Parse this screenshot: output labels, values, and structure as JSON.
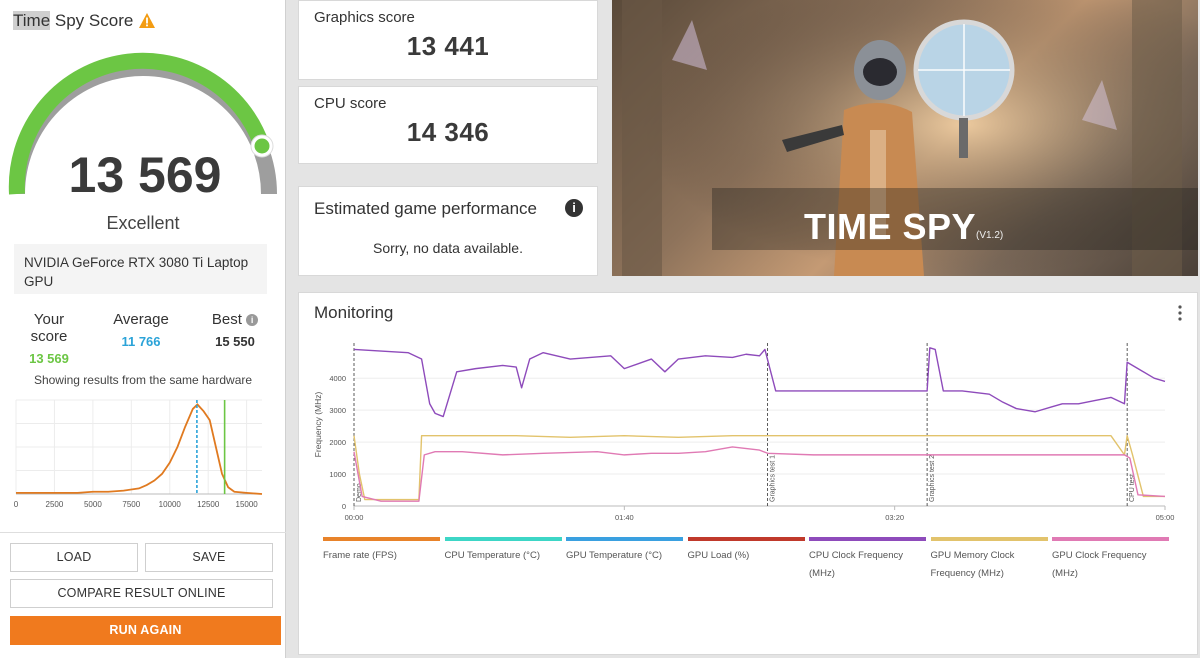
{
  "left": {
    "title_highlight": "Time",
    "title_rest": " Spy Score",
    "main_score": "13 569",
    "rating": "Excellent",
    "gpu_name": "NVIDIA GeForce RTX 3080 Ti Laptop GPU",
    "stats": {
      "your_label": "Your score",
      "your_value": "13 569",
      "avg_label": "Average",
      "avg_value": "11 766",
      "best_label": "Best",
      "best_value": "15 550"
    },
    "same_hardware_text": "Showing results from the same hardware",
    "dist_axis_labels": [
      "0",
      "2500",
      "5000",
      "7500",
      "10000",
      "12500",
      "15000"
    ],
    "buttons": {
      "load": "LOAD",
      "save": "SAVE",
      "compare": "COMPARE RESULT ONLINE",
      "run_again": "RUN AGAIN"
    }
  },
  "graphics": {
    "label": "Graphics score",
    "value": "13 441"
  },
  "cpu": {
    "label": "CPU score",
    "value": "14 346"
  },
  "game_performance": {
    "title": "Estimated game performance",
    "message": "Sorry, no data available."
  },
  "banner": {
    "title": "TIME SPY",
    "version": "(V1.2)"
  },
  "monitoring": {
    "title": "Monitoring",
    "y_axis_label": "Frequency (MHz)",
    "y_ticks": [
      "0",
      "1000",
      "2000",
      "3000",
      "4000"
    ],
    "x_ticks": [
      "00:00",
      "01:40",
      "03:20",
      "05:00"
    ],
    "markers": [
      "Demo",
      "Graphics test 1",
      "Graphics test 2",
      "CPU test"
    ],
    "legend": [
      {
        "label": "Frame rate (FPS)",
        "color": "#e8832a"
      },
      {
        "label": "CPU Temperature (°C)",
        "color": "#3dd6c6"
      },
      {
        "label": "GPU Temperature (°C)",
        "color": "#3aa0e0"
      },
      {
        "label": "GPU Load (%)",
        "color": "#c0392b"
      },
      {
        "label": "CPU Clock Frequency (MHz)",
        "color": "#8e4bbb"
      },
      {
        "label": "GPU Memory Clock Frequency (MHz)",
        "color": "#e2c36c"
      },
      {
        "label": "GPU Clock Frequency (MHz)",
        "color": "#e07ab4"
      }
    ]
  },
  "colors": {
    "score_green": "#6cc644",
    "average_blue": "#2ba3d8",
    "run_button": "#f07a1e",
    "warning": "#f39c12"
  },
  "icons": {
    "warning": "warning-icon",
    "info": "info-icon",
    "menu": "more-vert-icon"
  },
  "chart_data": [
    {
      "type": "line",
      "title": "",
      "xlabel": "",
      "ylabel": "",
      "x_ticks": [
        "0",
        "2500",
        "5000",
        "7500",
        "10000",
        "12500",
        "15000"
      ],
      "xlim": [
        0,
        16000
      ],
      "series": [
        {
          "x": [
            0,
            1000,
            2000,
            3000,
            4000,
            5000,
            6000,
            7000,
            8000,
            8500,
            9000,
            9500,
            10000,
            10500,
            11000,
            11500,
            11800,
            12200,
            12600,
            13000,
            13400,
            13800,
            14200,
            15000,
            16000
          ],
          "values": [
            1,
            1,
            1,
            1,
            1,
            2,
            2,
            3,
            5,
            8,
            12,
            18,
            28,
            42,
            60,
            76,
            80,
            74,
            66,
            42,
            18,
            6,
            2,
            1,
            0
          ]
        }
      ],
      "markers": [
        {
          "value": 11766,
          "color": "#2ba3d8",
          "style": "dashed"
        },
        {
          "value": 13569,
          "color": "#6cc644",
          "style": "solid"
        }
      ]
    },
    {
      "type": "line",
      "title": "",
      "ylabel": "Frequency (MHz)",
      "x_ticks": [
        "00:00",
        "01:40",
        "03:20",
        "05:00"
      ],
      "xlim": [
        0,
        300
      ],
      "ylim": [
        0,
        5000
      ],
      "event_markers": [
        {
          "t": 0,
          "label": "Demo"
        },
        {
          "t": 153,
          "label": "Graphics test 1"
        },
        {
          "t": 212,
          "label": "Graphics test 2"
        },
        {
          "t": 286,
          "label": "CPU test"
        }
      ],
      "series": [
        {
          "name": "CPU Clock Frequency (MHz)",
          "color": "#8e4bbb",
          "points": [
            [
              0,
              4900
            ],
            [
              10,
              4850
            ],
            [
              20,
              4800
            ],
            [
              25,
              4600
            ],
            [
              28,
              3200
            ],
            [
              30,
              2900
            ],
            [
              33,
              2800
            ],
            [
              38,
              4200
            ],
            [
              45,
              4300
            ],
            [
              55,
              4400
            ],
            [
              60,
              4350
            ],
            [
              62,
              3700
            ],
            [
              65,
              4600
            ],
            [
              70,
              4800
            ],
            [
              80,
              4600
            ],
            [
              95,
              4700
            ],
            [
              100,
              4300
            ],
            [
              110,
              4600
            ],
            [
              115,
              4200
            ],
            [
              120,
              4600
            ],
            [
              130,
              4700
            ],
            [
              140,
              4650
            ],
            [
              145,
              4750
            ],
            [
              150,
              4700
            ],
            [
              152,
              4900
            ],
            [
              156,
              3600
            ],
            [
              165,
              3600
            ],
            [
              180,
              3600
            ],
            [
              195,
              3600
            ],
            [
              205,
              3600
            ],
            [
              212,
              3600
            ],
            [
              213,
              4950
            ],
            [
              215,
              4900
            ],
            [
              218,
              3600
            ],
            [
              225,
              3600
            ],
            [
              235,
              3500
            ],
            [
              240,
              3250
            ],
            [
              245,
              3050
            ],
            [
              252,
              2950
            ],
            [
              258,
              3100
            ],
            [
              262,
              3200
            ],
            [
              268,
              3200
            ],
            [
              274,
              3300
            ],
            [
              280,
              3400
            ],
            [
              285,
              3200
            ],
            [
              286,
              4500
            ],
            [
              290,
              4300
            ],
            [
              296,
              4000
            ],
            [
              300,
              3900
            ]
          ]
        },
        {
          "name": "GPU Memory Clock Frequency (MHz)",
          "color": "#e2c36c",
          "points": [
            [
              0,
              2200
            ],
            [
              2,
              1000
            ],
            [
              4,
              200
            ],
            [
              10,
              200
            ],
            [
              20,
              200
            ],
            [
              24,
              200
            ],
            [
              25,
              2200
            ],
            [
              30,
              2200
            ],
            [
              60,
              2200
            ],
            [
              80,
              2150
            ],
            [
              100,
              2200
            ],
            [
              120,
              2150
            ],
            [
              140,
              2200
            ],
            [
              160,
              2200
            ],
            [
              180,
              2200
            ],
            [
              200,
              2200
            ],
            [
              220,
              2200
            ],
            [
              240,
              2200
            ],
            [
              260,
              2200
            ],
            [
              280,
              2200
            ],
            [
              285,
              1600
            ],
            [
              286,
              2200
            ],
            [
              288,
              1600
            ],
            [
              292,
              300
            ],
            [
              300,
              300
            ]
          ]
        },
        {
          "name": "GPU Clock Frequency (MHz)",
          "color": "#e07ab4",
          "points": [
            [
              0,
              1700
            ],
            [
              3,
              300
            ],
            [
              10,
              150
            ],
            [
              20,
              150
            ],
            [
              24,
              150
            ],
            [
              26,
              1600
            ],
            [
              30,
              1700
            ],
            [
              40,
              1700
            ],
            [
              55,
              1600
            ],
            [
              70,
              1650
            ],
            [
              90,
              1700
            ],
            [
              100,
              1600
            ],
            [
              110,
              1650
            ],
            [
              120,
              1650
            ],
            [
              130,
              1700
            ],
            [
              140,
              1850
            ],
            [
              150,
              1750
            ],
            [
              153,
              1650
            ],
            [
              170,
              1600
            ],
            [
              190,
              1600
            ],
            [
              212,
              1600
            ],
            [
              230,
              1600
            ],
            [
              250,
              1600
            ],
            [
              270,
              1600
            ],
            [
              285,
              1600
            ],
            [
              287,
              1500
            ],
            [
              290,
              350
            ],
            [
              300,
              300
            ]
          ]
        }
      ]
    }
  ]
}
